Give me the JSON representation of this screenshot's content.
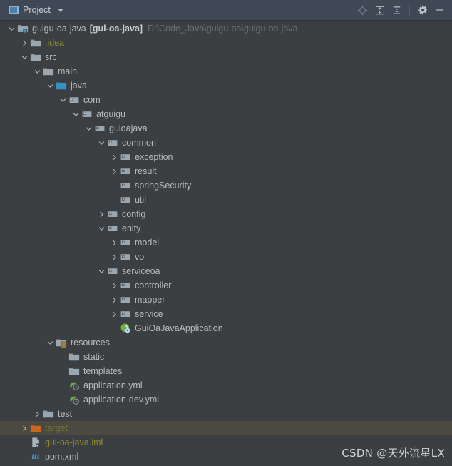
{
  "window": {
    "tool_window_title": "Project",
    "icons": {
      "project": "project-panel-icon",
      "dropdown": "chevron-down-icon",
      "locate": "locate-file-icon",
      "expand_all": "expand-all-icon",
      "collapse_all": "collapse-all-icon",
      "settings": "gear-icon",
      "hide": "minimize-icon"
    },
    "action_labels": {
      "locate": "Select Opened File",
      "expand_all": "Expand All",
      "collapse_all": "Collapse All",
      "settings": "Settings",
      "hide": "Hide"
    }
  },
  "theme": {
    "background": "#3c3f41",
    "header_background": "#3f4854",
    "selection_background": "#4c4a40",
    "text": "#bbbbbb",
    "dim_text": "#6b7075",
    "excluded_text": "#6e7a2a",
    "folder_gray": "#9aa7b0",
    "source_folder_blue": "#3592c4",
    "excluded_folder_orange": "#cc6723",
    "resources_badge_orange": "#d9a343",
    "maven_blue": "#3d9ad1",
    "spring_green": "#6db33f"
  },
  "tree": {
    "root": {
      "name": "guigu-oa-java",
      "module": "[gui-oa-java]",
      "path": "D:\\Code_Java\\guigu-oa\\guigu-oa-java"
    },
    "nodes": [
      {
        "label": ".idea",
        "depth": 1,
        "state": "collapsed",
        "icon": "folder-gray",
        "style": "olive"
      },
      {
        "label": "src",
        "depth": 1,
        "state": "expanded",
        "icon": "folder-gray",
        "style": "plain"
      },
      {
        "label": "main",
        "depth": 2,
        "state": "expanded",
        "icon": "folder-gray",
        "style": "plain"
      },
      {
        "label": "java",
        "depth": 3,
        "state": "expanded",
        "icon": "folder-source-blue",
        "style": "plain"
      },
      {
        "label": "com",
        "depth": 4,
        "state": "expanded",
        "icon": "package",
        "style": "plain"
      },
      {
        "label": "atguigu",
        "depth": 5,
        "state": "expanded",
        "icon": "package",
        "style": "plain"
      },
      {
        "label": "guioajava",
        "depth": 6,
        "state": "expanded",
        "icon": "package",
        "style": "plain"
      },
      {
        "label": "common",
        "depth": 7,
        "state": "expanded",
        "icon": "package",
        "style": "plain"
      },
      {
        "label": "exception",
        "depth": 8,
        "state": "collapsed",
        "icon": "package",
        "style": "plain"
      },
      {
        "label": "result",
        "depth": 8,
        "state": "collapsed",
        "icon": "package",
        "style": "plain"
      },
      {
        "label": "springSecurity",
        "depth": 8,
        "state": "leaf",
        "icon": "package",
        "style": "plain"
      },
      {
        "label": "util",
        "depth": 8,
        "state": "leaf",
        "icon": "package",
        "style": "plain"
      },
      {
        "label": "config",
        "depth": 7,
        "state": "collapsed",
        "icon": "package",
        "style": "plain"
      },
      {
        "label": "enity",
        "depth": 7,
        "state": "expanded",
        "icon": "package",
        "style": "plain"
      },
      {
        "label": "model",
        "depth": 8,
        "state": "collapsed",
        "icon": "package",
        "style": "plain"
      },
      {
        "label": "vo",
        "depth": 8,
        "state": "collapsed",
        "icon": "package",
        "style": "plain"
      },
      {
        "label": "serviceoa",
        "depth": 7,
        "state": "expanded",
        "icon": "package",
        "style": "plain"
      },
      {
        "label": "controller",
        "depth": 8,
        "state": "collapsed",
        "icon": "package",
        "style": "plain"
      },
      {
        "label": "mapper",
        "depth": 8,
        "state": "collapsed",
        "icon": "package",
        "style": "plain"
      },
      {
        "label": "service",
        "depth": 8,
        "state": "collapsed",
        "icon": "package",
        "style": "plain"
      },
      {
        "label": "GuiOaJavaApplication",
        "depth": 8,
        "state": "leaf",
        "icon": "spring-boot-run",
        "style": "plain"
      },
      {
        "label": "resources",
        "depth": 3,
        "state": "expanded",
        "icon": "folder-resources",
        "style": "plain"
      },
      {
        "label": "static",
        "depth": 4,
        "state": "leaf",
        "icon": "folder-gray",
        "style": "plain"
      },
      {
        "label": "templates",
        "depth": 4,
        "state": "leaf",
        "icon": "folder-gray",
        "style": "plain"
      },
      {
        "label": "application.yml",
        "depth": 4,
        "state": "leaf",
        "icon": "spring-yaml",
        "style": "plain"
      },
      {
        "label": "application-dev.yml",
        "depth": 4,
        "state": "leaf",
        "icon": "spring-yaml",
        "style": "plain"
      },
      {
        "label": "test",
        "depth": 2,
        "state": "collapsed",
        "icon": "folder-gray",
        "style": "plain"
      },
      {
        "label": "target",
        "depth": 1,
        "state": "collapsed",
        "icon": "folder-excluded",
        "style": "target",
        "selected": true
      },
      {
        "label": "gui-oa-java.iml",
        "depth": 1,
        "state": "leaf",
        "icon": "iml-file",
        "style": "olive"
      },
      {
        "label": "pom.xml",
        "depth": 1,
        "state": "leaf",
        "icon": "maven-file",
        "style": "plain"
      }
    ]
  },
  "watermark": {
    "text": "CSDN @天外流星LX"
  }
}
